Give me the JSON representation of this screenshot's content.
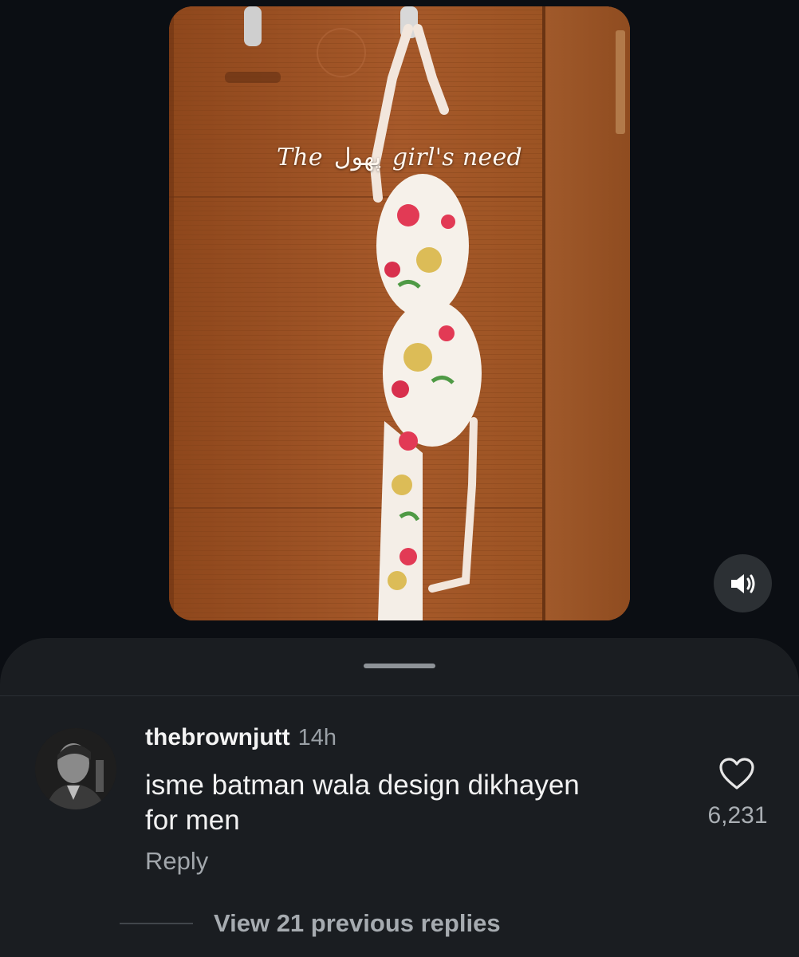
{
  "media": {
    "caption_prefix": "The",
    "caption_urdu": "پھول",
    "caption_suffix": "girl's need",
    "sound_icon": "speaker-on-icon"
  },
  "comment": {
    "username": "thebrownjutt",
    "time": "14h",
    "text_line1": "isme batman wala design dikhayen",
    "text_line2": "for men",
    "reply_label": "Reply",
    "like_icon": "heart-outline-icon",
    "like_count": "6,231",
    "view_replies_label": "View 21 previous replies"
  },
  "colors": {
    "background": "#0b0e13",
    "sheet": "#1a1d21",
    "secondary_text": "#a6abb0"
  }
}
